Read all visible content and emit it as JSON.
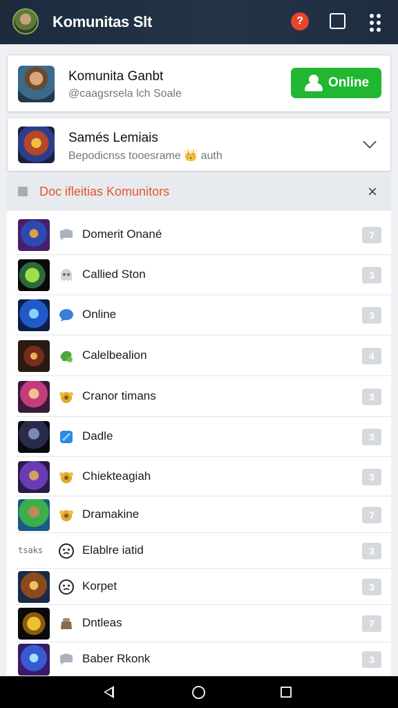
{
  "appbar": {
    "title": "Komunitas Slt",
    "help_label": "?",
    "icons": [
      "avatar",
      "help-icon",
      "square-icon",
      "more-vert-icon"
    ]
  },
  "profile_card": {
    "title": "Komunita Ganbt",
    "subtitle": "@caagsrsela lch Soale",
    "button_label": "Online",
    "button_color": "#21b731"
  },
  "group_card": {
    "title": "Samés Lemiais",
    "subtitle": "Bepodicnss tooesrame 👑 auth"
  },
  "section": {
    "label": "Doc ifleitias Komunitors",
    "label_color": "#e2582a",
    "close_label": "×"
  },
  "list_items": [
    {
      "name": "Domerit Onané",
      "badge": "7",
      "icon": "chat-bubble-icon",
      "thumb": "blue-game"
    },
    {
      "name": "Callied Ston",
      "badge": "3",
      "icon": "ghost-icon",
      "thumb": "green-blade"
    },
    {
      "name": "Online",
      "badge": "3",
      "icon": "blue-bubble-icon",
      "thumb": "blue-orb"
    },
    {
      "name": "Calelbealion",
      "badge": "4",
      "icon": "leaf-icon",
      "thumb": "brown-ring"
    },
    {
      "name": "Cranor timans",
      "badge": "3",
      "icon": "gold-badge-icon",
      "thumb": "pink-hero"
    },
    {
      "name": "Dadle",
      "badge": "3",
      "icon": "blue-shield-icon",
      "thumb": "dark-warrior"
    },
    {
      "name": "Chiekteagiah",
      "badge": "3",
      "icon": "gold-badge-icon",
      "thumb": "purple-knight"
    },
    {
      "name": "Dramakine",
      "badge": "7",
      "icon": "gold-badge-icon",
      "thumb": "green-field"
    },
    {
      "name": "Elablre iatid",
      "badge": "3",
      "icon": "face-icon",
      "thumb_text": "tsaks",
      "thumb": "text"
    },
    {
      "name": "Korpet",
      "badge": "3",
      "icon": "face-icon",
      "thumb": "bronze-hero"
    },
    {
      "name": "Dntleas",
      "badge": "7",
      "icon": "gold-pouch-icon",
      "thumb": "gold-mask"
    },
    {
      "name": "Baber Rkonk",
      "badge": "3",
      "icon": "chat-bubble-icon",
      "thumb": "blue-mage"
    }
  ],
  "nav": {
    "icons": [
      "back-icon",
      "home-icon",
      "recents-icon"
    ]
  }
}
